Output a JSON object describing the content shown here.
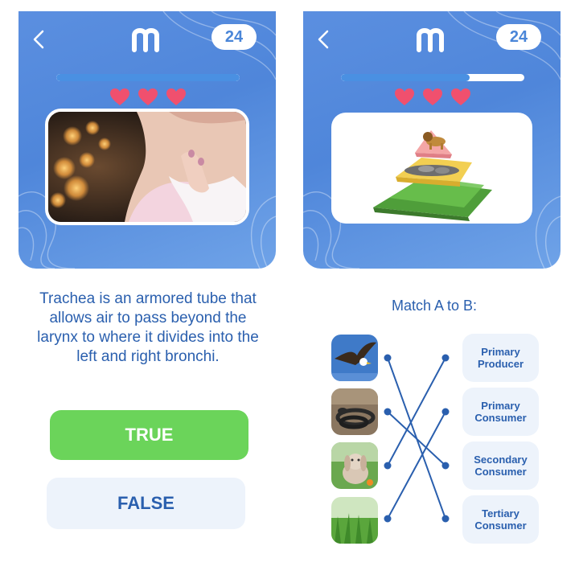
{
  "left_screen": {
    "counter": "24",
    "progress": 1.0,
    "lives": 3,
    "question": "Trachea is an armored tube that allows air to pass beyond the larynx to where it divides into the left and right bronchi.",
    "true_label": "TRUE",
    "false_label": "FALSE"
  },
  "right_screen": {
    "counter": "24",
    "progress": 0.7,
    "lives": 3,
    "match_title": "Match A to B:",
    "column_b": [
      "Primary Producer",
      "Primary Consumer",
      "Secondary Consumer",
      "Tertiary Consumer"
    ]
  },
  "colors": {
    "panel_blue": "#5b8fe0",
    "accent_blue": "#2a5fae",
    "true_green": "#6bd45a",
    "heart_red": "#f0506e",
    "card_bg": "#edf3fb"
  },
  "icons": [
    "back-chevron-icon",
    "brand-logo-icon",
    "heart-icon"
  ]
}
